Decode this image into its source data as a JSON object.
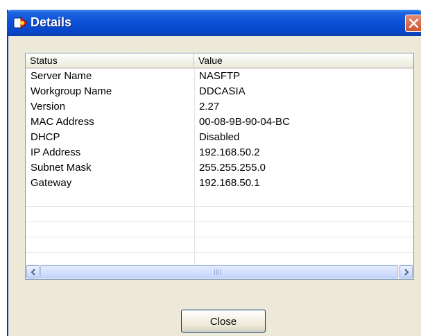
{
  "window": {
    "title": "Details",
    "icons": {
      "app": "red-app-icon",
      "close": "close-x-icon"
    }
  },
  "listview": {
    "columns": [
      "Status",
      "Value"
    ],
    "rows": [
      {
        "status": "Server Name",
        "value": "NASFTP"
      },
      {
        "status": "Workgroup Name",
        "value": "DDCASIA"
      },
      {
        "status": "Version",
        "value": "2.27"
      },
      {
        "status": "MAC Address",
        "value": "00-08-9B-90-04-BC"
      },
      {
        "status": "DHCP",
        "value": "Disabled"
      },
      {
        "status": "IP Address",
        "value": "192.168.50.2"
      },
      {
        "status": "Subnet Mask",
        "value": "255.255.255.0"
      },
      {
        "status": "Gateway",
        "value": "192.168.50.1"
      }
    ],
    "scrollbar": {
      "left_icon": "chevron-left-icon",
      "right_icon": "chevron-right-icon"
    }
  },
  "footer": {
    "close_label": "Close"
  },
  "colors": {
    "titlebar": "#0a4fd6",
    "dialog_bg": "#ece9d8",
    "close_button": "#d3532f",
    "list_border": "#7f9db9"
  }
}
